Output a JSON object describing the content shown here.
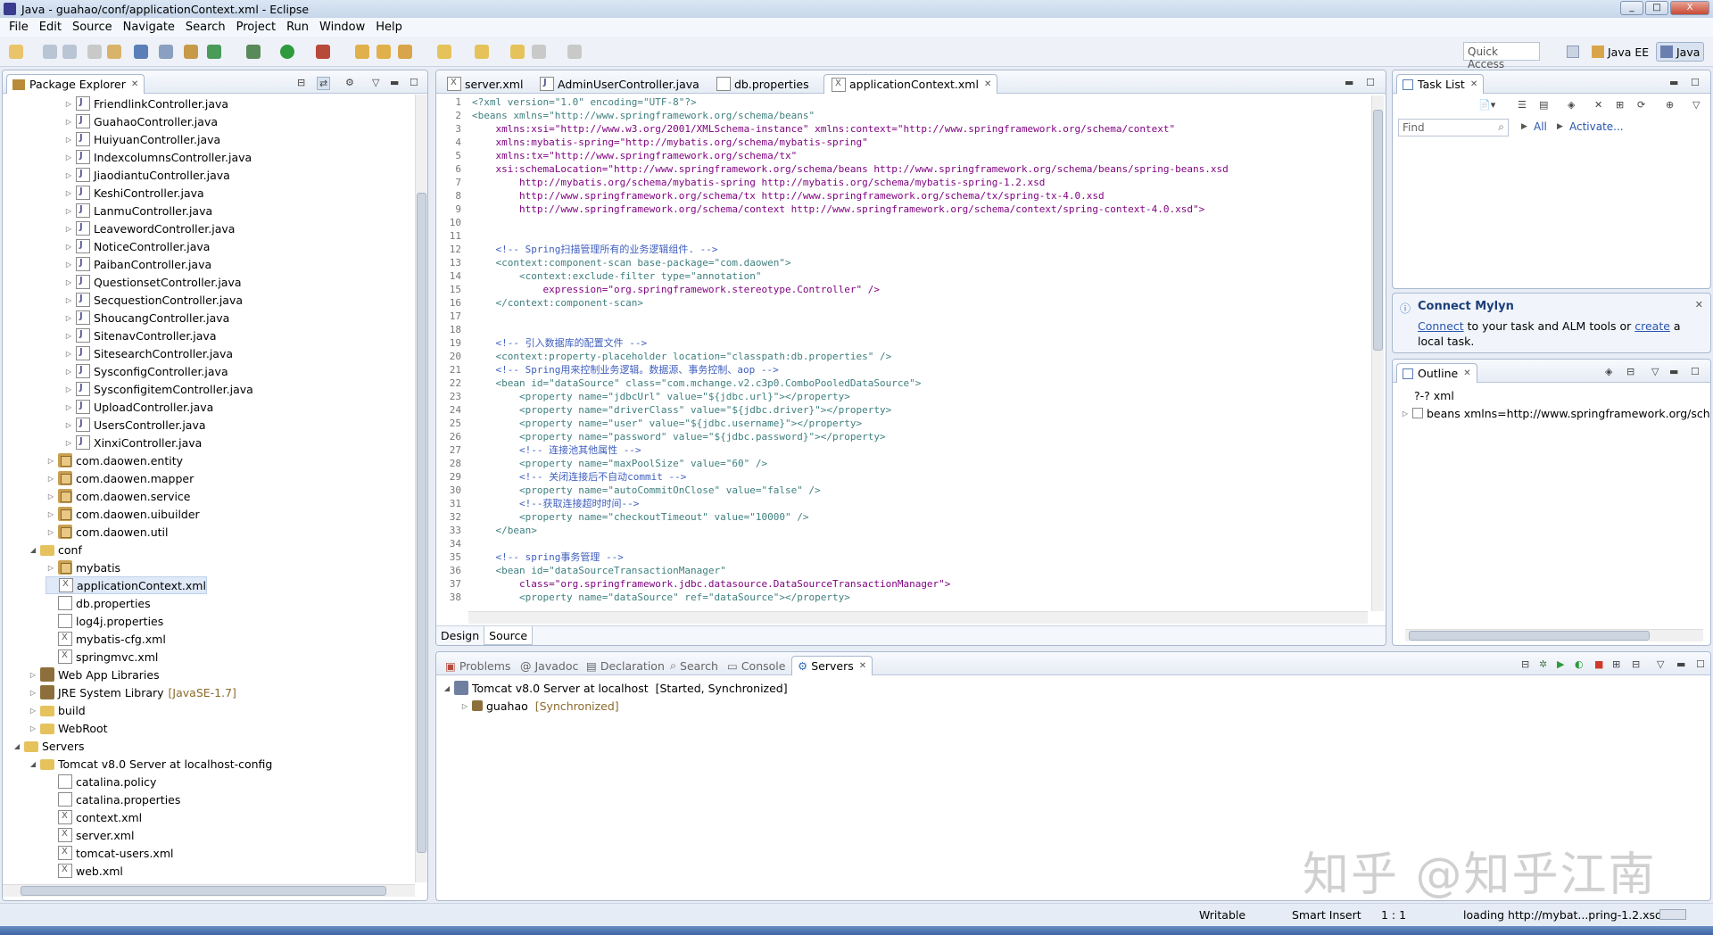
{
  "window": {
    "title": "Java - guahao/conf/applicationContext.xml - Eclipse",
    "min": "_",
    "max": "□",
    "close": "X"
  },
  "menu": [
    "File",
    "Edit",
    "Source",
    "Navigate",
    "Search",
    "Project",
    "Run",
    "Window",
    "Help"
  ],
  "quick_access": {
    "placeholder": "Quick Access"
  },
  "perspectives": [
    "Java EE",
    "Java"
  ],
  "package_explorer": {
    "title": "Package Explorer",
    "items": [
      {
        "label": "FriendlinkController.java",
        "icon": "java",
        "level": 4
      },
      {
        "label": "GuahaoController.java",
        "icon": "java",
        "level": 4
      },
      {
        "label": "HuiyuanController.java",
        "icon": "java",
        "level": 4
      },
      {
        "label": "IndexcolumnsController.java",
        "icon": "java",
        "level": 4
      },
      {
        "label": "JiaodiantuController.java",
        "icon": "java",
        "level": 4
      },
      {
        "label": "KeshiController.java",
        "icon": "java",
        "level": 4
      },
      {
        "label": "LanmuController.java",
        "icon": "java",
        "level": 4
      },
      {
        "label": "LeavewordController.java",
        "icon": "java",
        "level": 4
      },
      {
        "label": "NoticeController.java",
        "icon": "java",
        "level": 4
      },
      {
        "label": "PaibanController.java",
        "icon": "java",
        "level": 4
      },
      {
        "label": "QuestionsetController.java",
        "icon": "java",
        "level": 4
      },
      {
        "label": "SecquestionController.java",
        "icon": "java",
        "level": 4
      },
      {
        "label": "ShoucangController.java",
        "icon": "java",
        "level": 4
      },
      {
        "label": "SitenavController.java",
        "icon": "java",
        "level": 4
      },
      {
        "label": "SitesearchController.java",
        "icon": "java",
        "level": 4
      },
      {
        "label": "SysconfigController.java",
        "icon": "java",
        "level": 4
      },
      {
        "label": "SysconfigitemController.java",
        "icon": "java",
        "level": 4
      },
      {
        "label": "UploadController.java",
        "icon": "java",
        "level": 4
      },
      {
        "label": "UsersController.java",
        "icon": "java",
        "level": 4
      },
      {
        "label": "XinxiController.java",
        "icon": "java",
        "level": 4
      },
      {
        "label": "com.daowen.entity",
        "icon": "pkg",
        "level": 3
      },
      {
        "label": "com.daowen.mapper",
        "icon": "pkg",
        "level": 3
      },
      {
        "label": "com.daowen.service",
        "icon": "pkg",
        "level": 3
      },
      {
        "label": "com.daowen.uibuilder",
        "icon": "pkg",
        "level": 3
      },
      {
        "label": "com.daowen.util",
        "icon": "pkg",
        "level": 3
      },
      {
        "label": "conf",
        "icon": "folder",
        "level": 2,
        "open": true
      },
      {
        "label": "mybatis",
        "icon": "pkg",
        "level": 3
      },
      {
        "label": "applicationContext.xml",
        "icon": "xml",
        "level": 3,
        "selected": true
      },
      {
        "label": "db.properties",
        "icon": "file",
        "level": 3
      },
      {
        "label": "log4j.properties",
        "icon": "file",
        "level": 3
      },
      {
        "label": "mybatis-cfg.xml",
        "icon": "xml",
        "level": 3
      },
      {
        "label": "springmvc.xml",
        "icon": "xml",
        "level": 3
      },
      {
        "label": "Web App Libraries",
        "icon": "lib",
        "level": 2
      },
      {
        "label": "JRE System Library",
        "extra": "[JavaSE-1.7]",
        "icon": "lib",
        "level": 2
      },
      {
        "label": "build",
        "icon": "folder",
        "level": 2
      },
      {
        "label": "WebRoot",
        "icon": "folder",
        "level": 2
      },
      {
        "label": "Servers",
        "icon": "folder",
        "level": 1,
        "open": true
      },
      {
        "label": "Tomcat v8.0 Server at localhost-config",
        "icon": "folder",
        "level": 2,
        "open": true
      },
      {
        "label": "catalina.policy",
        "icon": "file",
        "level": 3
      },
      {
        "label": "catalina.properties",
        "icon": "file",
        "level": 3
      },
      {
        "label": "context.xml",
        "icon": "xml",
        "level": 3
      },
      {
        "label": "server.xml",
        "icon": "xml",
        "level": 3
      },
      {
        "label": "tomcat-users.xml",
        "icon": "xml",
        "level": 3
      },
      {
        "label": "web.xml",
        "icon": "xml",
        "level": 3
      }
    ]
  },
  "editor": {
    "tabs": [
      "server.xml",
      "AdminUserController.java",
      "db.properties",
      "applicationContext.xml"
    ],
    "active_tab": 3,
    "mode_tabs": [
      "Design",
      "Source"
    ],
    "lines": [
      "<?xml version=\"1.0\" encoding=\"UTF-8\"?>",
      "<beans xmlns=\"http://www.springframework.org/schema/beans\"",
      "    xmlns:xsi=\"http://www.w3.org/2001/XMLSchema-instance\" xmlns:context=\"http://www.springframework.org/schema/context\"",
      "    xmlns:mybatis-spring=\"http://mybatis.org/schema/mybatis-spring\"",
      "    xmlns:tx=\"http://www.springframework.org/schema/tx\"",
      "    xsi:schemaLocation=\"http://www.springframework.org/schema/beans http://www.springframework.org/schema/beans/spring-beans.xsd",
      "        http://mybatis.org/schema/mybatis-spring http://mybatis.org/schema/mybatis-spring-1.2.xsd",
      "        http://www.springframework.org/schema/tx http://www.springframework.org/schema/tx/spring-tx-4.0.xsd",
      "        http://www.springframework.org/schema/context http://www.springframework.org/schema/context/spring-context-4.0.xsd\">",
      "",
      "",
      "    <!-- Spring扫描管理所有的业务逻辑组件. -->",
      "    <context:component-scan base-package=\"com.daowen\">",
      "        <context:exclude-filter type=\"annotation\"",
      "            expression=\"org.springframework.stereotype.Controller\" />",
      "    </context:component-scan>",
      "",
      "",
      "    <!-- 引入数据库的配置文件 -->",
      "    <context:property-placeholder location=\"classpath:db.properties\" />",
      "    <!-- Spring用来控制业务逻辑。数据源、事务控制、aop -->",
      "    <bean id=\"dataSource\" class=\"com.mchange.v2.c3p0.ComboPooledDataSource\">",
      "        <property name=\"jdbcUrl\" value=\"${jdbc.url}\"></property>",
      "        <property name=\"driverClass\" value=\"${jdbc.driver}\"></property>",
      "        <property name=\"user\" value=\"${jdbc.username}\"></property>",
      "        <property name=\"password\" value=\"${jdbc.password}\"></property>",
      "        <!-- 连接池其他属性 -->",
      "        <property name=\"maxPoolSize\" value=\"60\" />",
      "        <!-- 关闭连接后不自动commit -->",
      "        <property name=\"autoCommitOnClose\" value=\"false\" />",
      "        <!--获取连接超时时间-->",
      "        <property name=\"checkoutTimeout\" value=\"10000\" />",
      "    </bean>",
      "",
      "    <!-- spring事务管理 -->",
      "    <bean id=\"dataSourceTransactionManager\"",
      "        class=\"org.springframework.jdbc.datasource.DataSourceTransactionManager\">",
      "        <property name=\"dataSource\" ref=\"dataSource\"></property>"
    ]
  },
  "task_list": {
    "title": "Task List",
    "find_placeholder": "Find",
    "all": "All",
    "activate": "Activate..."
  },
  "mylyn": {
    "title": "Connect Mylyn",
    "connect": "Connect",
    "text1": " to your task and ALM tools or ",
    "create": "create",
    "text2": " a local task."
  },
  "outline": {
    "title": "Outline",
    "items": [
      "?-? xml",
      "beans xmlns=http://www.springframework.org/schem"
    ]
  },
  "bottom": {
    "tabs": [
      "Problems",
      "Javadoc",
      "Declaration",
      "Search",
      "Console",
      "Servers"
    ],
    "active_tab": 5,
    "server": "Tomcat v8.0 Server at localhost",
    "server_state": "[Started, Synchronized]",
    "module": "guahao",
    "module_state": "[Synchronized]"
  },
  "status": {
    "writable": "Writable",
    "insert": "Smart Insert",
    "position": "1 : 1",
    "loading": "loading http://mybat...pring-1.2.xsd"
  },
  "watermark": "知乎 @知乎江南"
}
